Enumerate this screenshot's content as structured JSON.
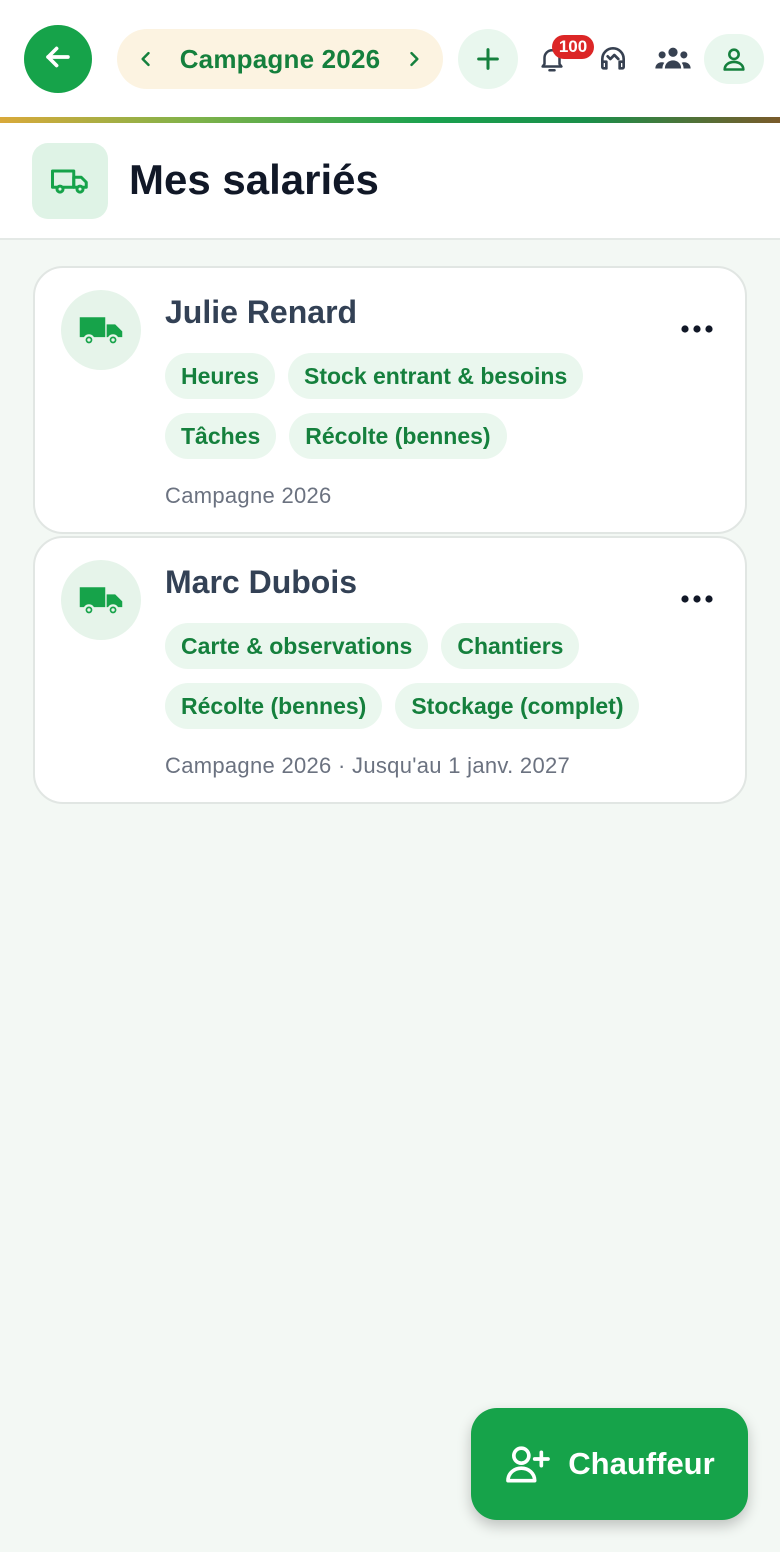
{
  "topbar": {
    "season_label": "Campagne 2026",
    "notification_count": "100",
    "icons": {
      "back": "arrow-left-icon",
      "prev": "chevron-left-icon",
      "next": "chevron-right-icon",
      "add": "plus-icon",
      "notifications": "bell-icon",
      "support": "headset-icon",
      "team": "users-icon",
      "profile": "user-icon"
    }
  },
  "header": {
    "title": "Mes salariés",
    "icon": "truck-icon"
  },
  "employees": [
    {
      "name": "Julie Renard",
      "chip_rows": [
        [
          "Heures",
          "Stock entrant & besoins"
        ],
        [
          "Tâches",
          "Récolte (bennes)"
        ]
      ],
      "meta": "Campagne 2026"
    },
    {
      "name": "Marc Dubois",
      "chip_rows": [
        [
          "Carte & observations",
          "Chantiers"
        ],
        [
          "Récolte (bennes)",
          "Stockage (complet)"
        ]
      ],
      "meta": "Campagne 2026 · Jusqu'au 1 janv. 2027"
    }
  ],
  "fab": {
    "label": "Chauffeur",
    "icon": "user-plus-icon"
  },
  "colors": {
    "primary": "#16a34a",
    "primary_dark": "#15803d",
    "chip_bg": "#eaf7ee",
    "pill_bg": "#fcf3e1",
    "badge": "#dc2626",
    "background": "#f3f8f4"
  }
}
